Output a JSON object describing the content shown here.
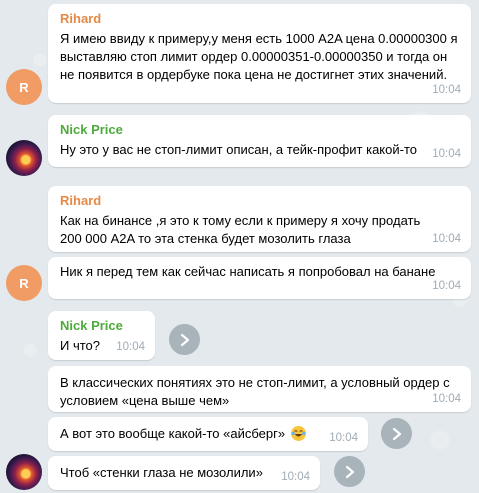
{
  "chat": {
    "messages": [
      {
        "sender": "Rihard",
        "text": "Я имею ввиду к примеру,у меня есть 1000 A2A цена 0.00000300 я выставляю стоп лимит ордер 0.00000351-0.00000350 и тогда он не появится в ордербуке пока цена не достигнет этих значений.",
        "time": "10:04"
      },
      {
        "sender": "Nick Price",
        "text": "Ну это у вас не стоп-лимит описан, а тейк-профит какой-то",
        "time": "10:04"
      },
      {
        "sender": "Rihard",
        "text": "Как на бинансе ,я это к тому если к примеру я хочу продать 200 000 A2A то эта  стенка будет мозолить глаза",
        "time": "10:04"
      },
      {
        "sender": "",
        "text": "Ник я перед тем как сейчас написать я попробовал на банане",
        "time": "10:04"
      },
      {
        "sender": "Nick Price",
        "text": "И что?",
        "time": "10:04"
      },
      {
        "sender": "",
        "text": "В классических понятиях это не стоп-лимит, а условный ордер с условием «цена выше чем»",
        "time": "10:04"
      },
      {
        "sender": "",
        "text": "А вот это вообще какой-то «айсберг»",
        "time": "10:04"
      },
      {
        "sender": "",
        "text": "Чтоб «стенки глаза не мозолили»",
        "time": "10:04"
      }
    ],
    "avatars": {
      "rihard_initial": "R"
    },
    "icons": {
      "forward": "forward-arrow-icon",
      "emoji": "laughing-tears-emoji"
    },
    "colors": {
      "rihard_name": "#e68946",
      "nick_name": "#4faa3c",
      "rihard_avatar": "#f19b65"
    }
  }
}
